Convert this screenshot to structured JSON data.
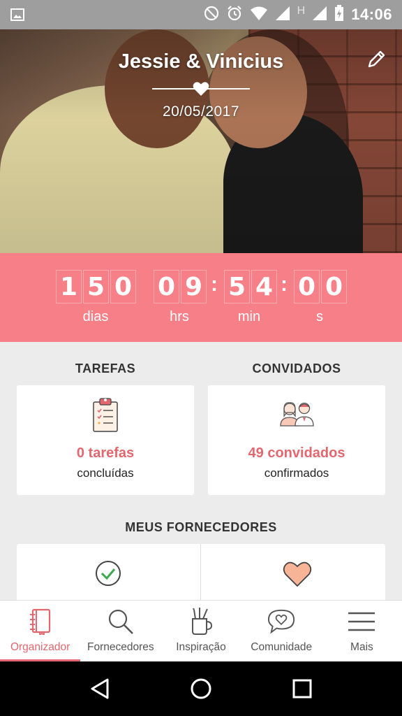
{
  "status_bar": {
    "time": "14:06",
    "network_letter": "H",
    "icons": [
      "image-icon",
      "do-not-disturb-icon",
      "alarm-icon",
      "wifi-icon",
      "signal-icon",
      "signal-icon",
      "battery-charging-icon"
    ]
  },
  "hero": {
    "names": "Jessie & Vinicius",
    "date": "20/05/2017",
    "edit_icon": "pencil-icon",
    "divider_icon": "heart-icon"
  },
  "countdown": {
    "days": [
      "1",
      "5",
      "0"
    ],
    "hours": [
      "0",
      "9"
    ],
    "minutes": [
      "5",
      "4"
    ],
    "seconds": [
      "0",
      "0"
    ],
    "separator": ":",
    "labels": {
      "days": "dias",
      "hours": "hrs",
      "minutes": "min",
      "seconds": "s"
    },
    "background_color": "#f77f87"
  },
  "tasks": {
    "title": "TAREFAS",
    "count_text": "0 tarefas",
    "sub_text": "concluídas",
    "icon": "clipboard-checklist-icon"
  },
  "guests": {
    "title": "CONVIDADOS",
    "count_text": "49 convidados",
    "sub_text": "confirmados",
    "icon": "couple-guests-icon"
  },
  "vendors": {
    "title": "MEUS FORNECEDORES",
    "icons": [
      "check-circle-icon",
      "heart-icon"
    ]
  },
  "bottom_nav": {
    "items": [
      {
        "label": "Organizador",
        "icon": "notebook-icon",
        "active": true
      },
      {
        "label": "Fornecedores",
        "icon": "search-icon",
        "active": false
      },
      {
        "label": "Inspiração",
        "icon": "pencil-cup-icon",
        "active": false
      },
      {
        "label": "Comunidade",
        "icon": "chat-heart-icon",
        "active": false
      },
      {
        "label": "Mais",
        "icon": "menu-icon",
        "active": false
      }
    ]
  },
  "system_nav": [
    "back-icon",
    "home-icon",
    "recents-icon"
  ],
  "colors": {
    "accent": "#e2676e",
    "countdown_bg": "#f77f87",
    "status_bar": "#9e9e9e",
    "page_bg": "#ececec"
  }
}
